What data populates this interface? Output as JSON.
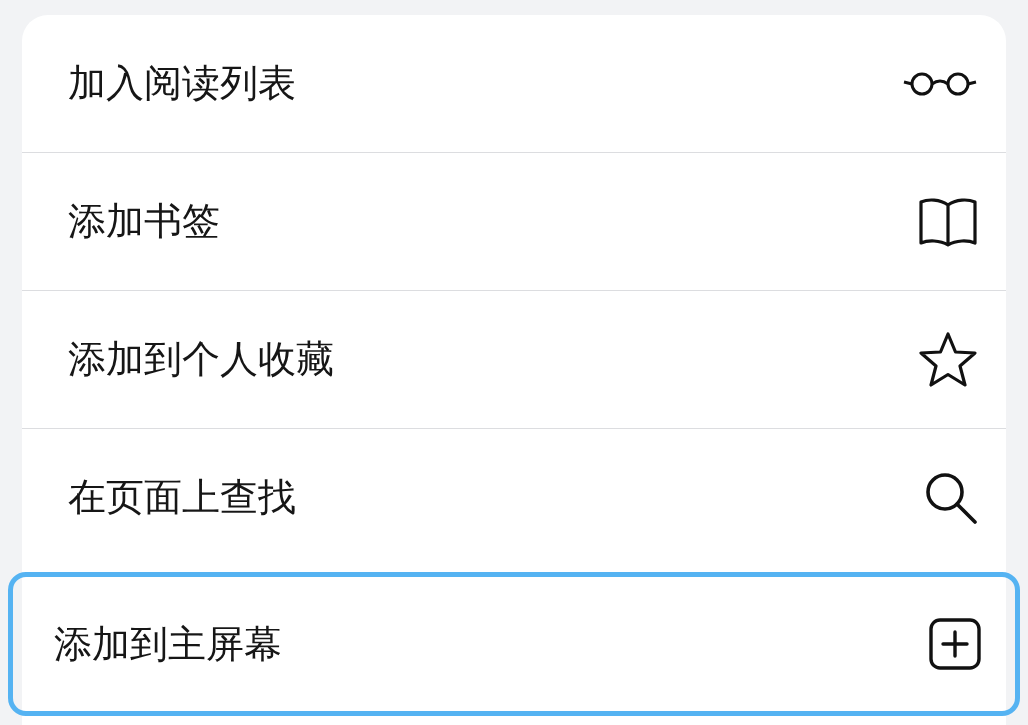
{
  "menu": {
    "items": [
      {
        "label": "加入阅读列表",
        "highlighted": false
      },
      {
        "label": "添加书签",
        "highlighted": false
      },
      {
        "label": "添加到个人收藏",
        "highlighted": false
      },
      {
        "label": "在页面上查找",
        "highlighted": false
      },
      {
        "label": "添加到主屏幕",
        "highlighted": true
      }
    ]
  }
}
